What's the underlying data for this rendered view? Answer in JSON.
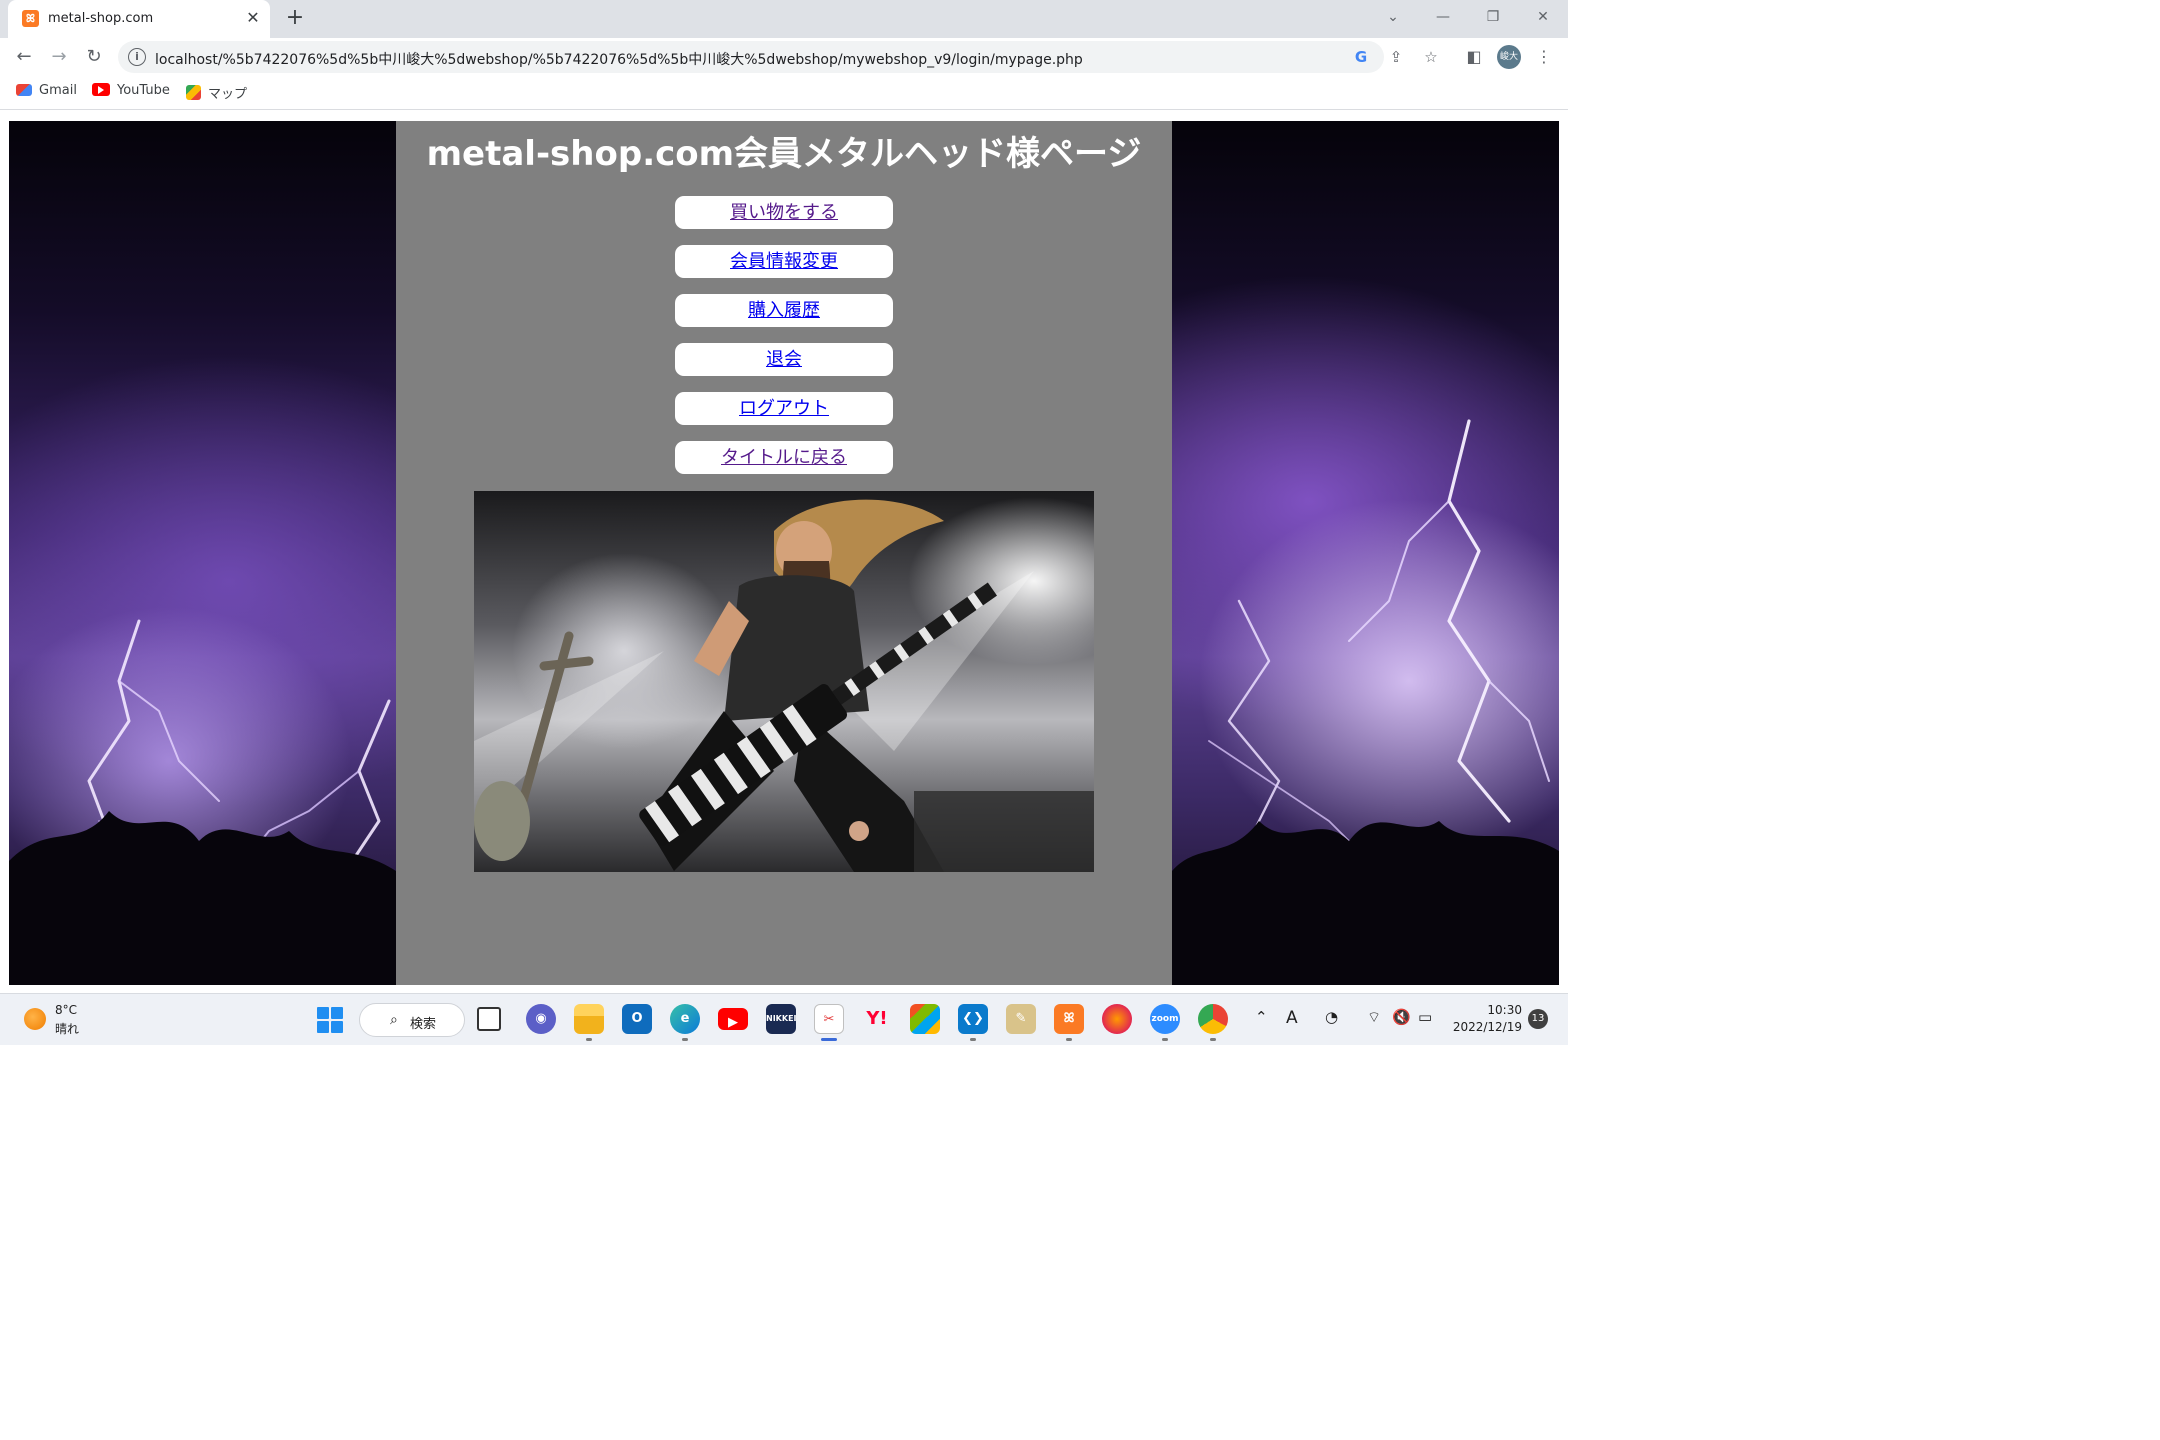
{
  "browser": {
    "tab": {
      "title": "metal-shop.com",
      "favicon": "xampp-icon"
    },
    "url": "localhost/%5b7422076%5d%5b中川峻大%5dwebshop/%5b7422076%5d%5b中川峻大%5dwebshop/mywebshop_v9/login/mypage.php",
    "profile_initials": "峻大",
    "bookmarks": [
      {
        "label": "Gmail",
        "icon": "gmail-icon"
      },
      {
        "label": "YouTube",
        "icon": "youtube-icon"
      },
      {
        "label": "マップ",
        "icon": "maps-icon"
      }
    ]
  },
  "page": {
    "title": "metal-shop.com会員メタルヘッド様ページ",
    "menu": [
      {
        "label": "買い物をする",
        "visited": true
      },
      {
        "label": "会員情報変更",
        "visited": false
      },
      {
        "label": "購入履歴",
        "visited": false
      },
      {
        "label": "退会",
        "visited": false
      },
      {
        "label": "ログアウト",
        "visited": false
      },
      {
        "label": "タイトルに戻る",
        "visited": true
      }
    ],
    "colors": {
      "panel": "#808080",
      "link": "#0000ee",
      "visited_link": "#551a8b",
      "background_theme": "purple-lightning"
    }
  },
  "taskbar": {
    "weather": {
      "temp": "8°C",
      "condition": "晴れ"
    },
    "search_label": "検索",
    "apps": [
      "task-view",
      "teams-chat",
      "file-explorer",
      "outlook",
      "edge",
      "youtube",
      "nikkei",
      "snipping-tool",
      "yahoo",
      "microsoft-store",
      "vscode",
      "notepad",
      "xampp",
      "firefox",
      "zoom",
      "chrome"
    ],
    "nikkei_label": "NIKKEI",
    "zoom_label": "zoom",
    "yahoo_label": "Y!",
    "tray": {
      "ime": "A"
    },
    "clock": {
      "time": "10:30",
      "date": "2022/12/19"
    },
    "notifications": "13"
  }
}
